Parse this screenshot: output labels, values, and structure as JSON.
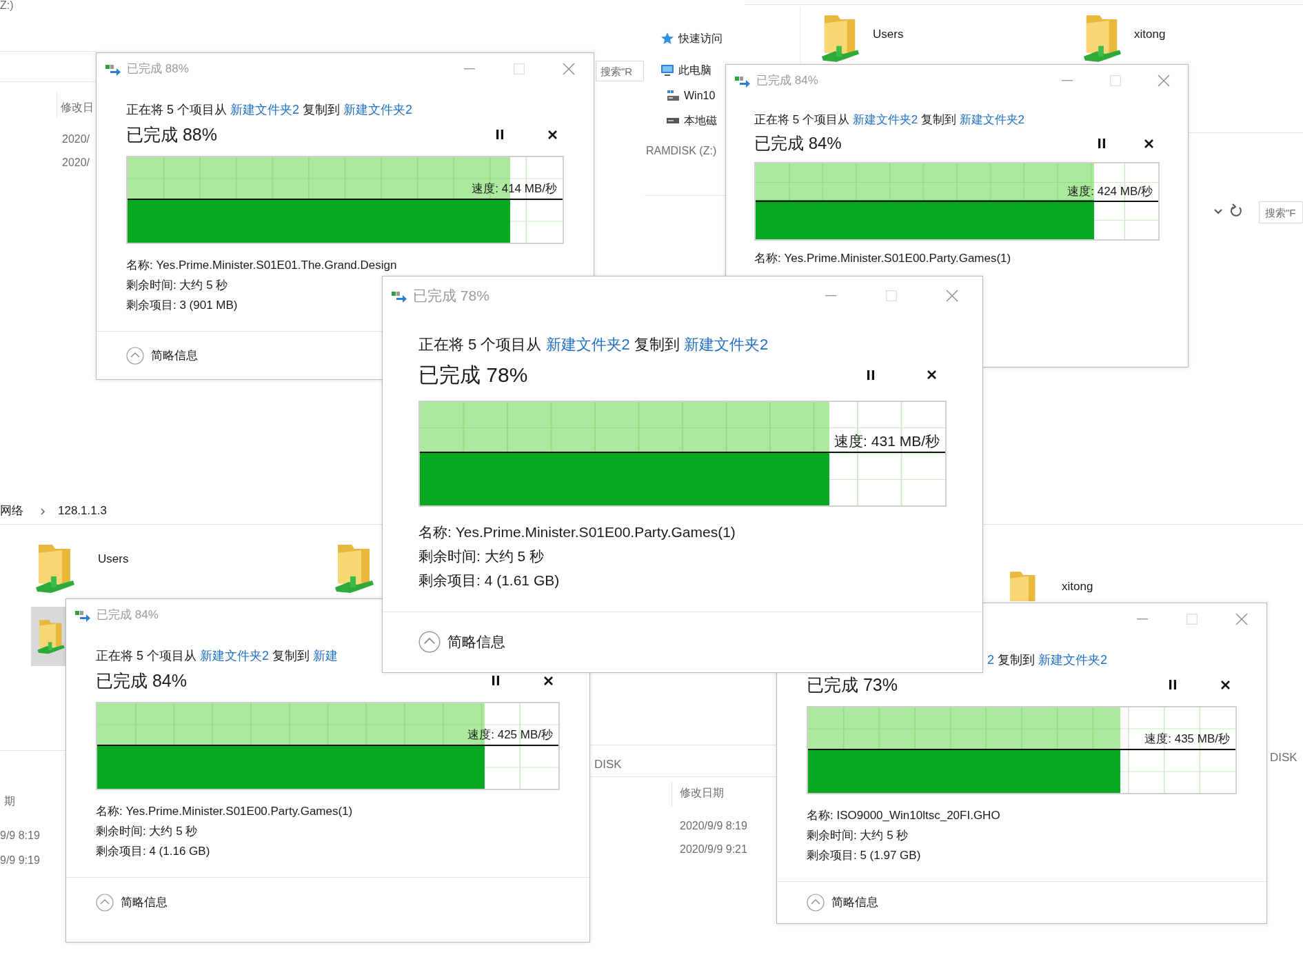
{
  "explorer_top_left": {
    "drive_label": "Z:)",
    "column_header": "修改日",
    "dates": [
      "2020/",
      "2020/"
    ],
    "search_placeholder": "搜索\"R"
  },
  "explorer_top_right": {
    "nav_items": [
      {
        "label": "快速访问",
        "kind": "star"
      },
      {
        "label": "此电脑",
        "kind": "computer"
      },
      {
        "label": "Win10",
        "kind": "network"
      },
      {
        "label": "本地磁",
        "kind": "disk"
      }
    ],
    "drive_label": "RAMDISK (Z:)",
    "folders": [
      {
        "name": "Users"
      },
      {
        "name": "xitong"
      }
    ],
    "search_placeholder": "搜索\"F"
  },
  "explorer_bottom_left": {
    "breadcrumb": [
      "网络",
      "128.1.1.3"
    ],
    "folders": [
      {
        "name": "Users"
      }
    ],
    "column_header": "期",
    "dates": [
      "9/9 8:19",
      "9/9 9:19"
    ],
    "drive_label": "DISK"
  },
  "explorer_bottom_right": {
    "folders": [
      {
        "name": "xitong"
      }
    ],
    "column_header": "修改日期",
    "dates": [
      "2020/9/9 8:19",
      "2020/9/9 9:21"
    ],
    "drive_label": "DISK"
  },
  "dialogs": [
    {
      "title": "已完成 88%",
      "description": [
        {
          "kind": "plain",
          "text": "正在将 5 个项目从"
        },
        {
          "kind": "link",
          "text": "新建文件夹2"
        },
        {
          "kind": "plain",
          "text": "复制到"
        },
        {
          "kind": "link",
          "text": "新建文件夹2"
        }
      ],
      "progress_label": "已完成 88%",
      "level": 0.88,
      "speed": "速度: 414 MB/秒",
      "details": [
        "名称: Yes.Prime.Minister.S01E01.The.Grand.Design",
        "剩余时间: 大约 5 秒",
        "剩余项目: 3 (901 MB)"
      ],
      "footer": "简略信息"
    },
    {
      "title": "已完成 84%",
      "description": [
        {
          "kind": "plain",
          "text": "正在将 5 个项目从"
        },
        {
          "kind": "link",
          "text": "新建文件夹2"
        },
        {
          "kind": "plain",
          "text": "复制到"
        },
        {
          "kind": "link",
          "text": "新建文件夹2"
        }
      ],
      "progress_label": "已完成 84%",
      "level": 0.84,
      "speed": "速度: 424 MB/秒",
      "details": [
        "名称: Yes.Prime.Minister.S01E00.Party.Games(1)"
      ]
    },
    {
      "title": "已完成 78%",
      "description": [
        {
          "kind": "plain",
          "text": "正在将 5 个项目从"
        },
        {
          "kind": "link",
          "text": "新建文件夹2"
        },
        {
          "kind": "plain",
          "text": "复制到"
        },
        {
          "kind": "link",
          "text": "新建文件夹2"
        }
      ],
      "progress_label": "已完成 78%",
      "level": 0.78,
      "speed": "速度: 431 MB/秒",
      "details": [
        "名称: Yes.Prime.Minister.S01E00.Party.Games(1)",
        "剩余时间: 大约 5 秒",
        "剩余项目: 4 (1.61 GB)"
      ],
      "footer": "简略信息"
    },
    {
      "title": "已完成 84%",
      "description": [
        {
          "kind": "plain",
          "text": "正在将 5 个项目从"
        },
        {
          "kind": "link",
          "text": "新建文件夹2"
        },
        {
          "kind": "plain",
          "text": "复制到"
        },
        {
          "kind": "link",
          "text": "新建"
        }
      ],
      "progress_label": "已完成 84%",
      "level": 0.84,
      "speed": "速度: 425 MB/秒",
      "details": [
        "名称: Yes.Prime.Minister.S01E00.Party.Games(1)",
        "剩余时间: 大约 5 秒",
        "剩余项目: 4 (1.16 GB)"
      ],
      "footer": "简略信息"
    },
    {
      "description": [
        {
          "kind": "link",
          "text": "2"
        },
        {
          "kind": "plain",
          "text": "复制到"
        },
        {
          "kind": "link",
          "text": "新建文件夹2"
        }
      ],
      "progress_label": "已完成 73%",
      "level": 0.73,
      "speed": "速度: 435 MB/秒",
      "details": [
        "名称: ISO9000_Win10ltsc_20FI.GHO",
        "剩余时间: 大约 5 秒",
        "剩余项目: 5 (1.97 GB)"
      ],
      "footer": "简略信息"
    }
  ]
}
